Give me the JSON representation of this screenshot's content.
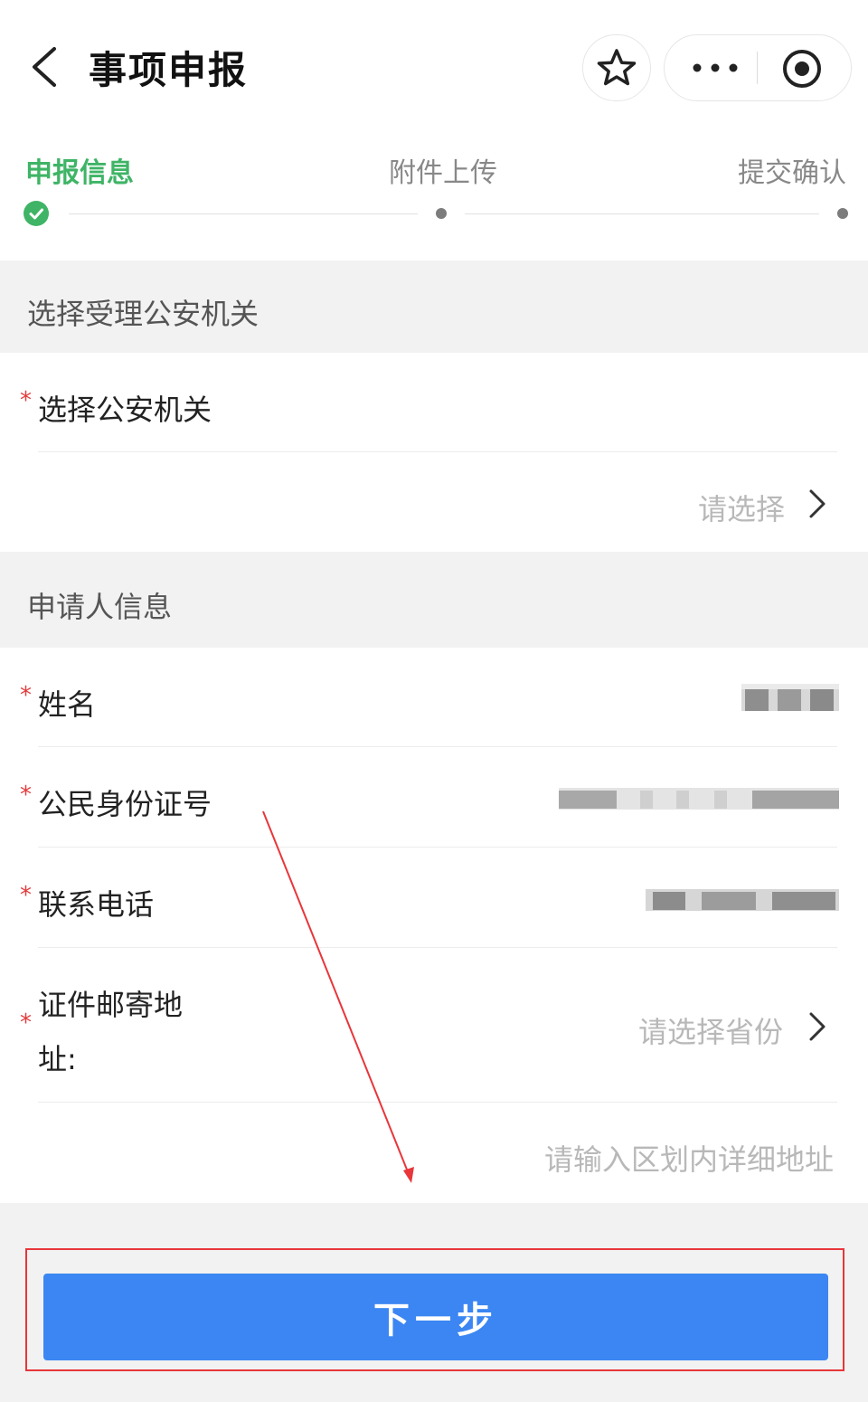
{
  "nav": {
    "title": "事项申报",
    "back_icon": "chevron-left-icon",
    "favorite_icon": "star-icon",
    "more_icon": "more-dots-icon",
    "close_icon": "target-circle-icon"
  },
  "steps": {
    "items": [
      {
        "label": "申报信息",
        "status": "done"
      },
      {
        "label": "附件上传",
        "status": "pending"
      },
      {
        "label": "提交确认",
        "status": "pending"
      }
    ],
    "active_color": "#3fb466"
  },
  "police_section": {
    "title": "选择受理公安机关",
    "field_label": "选择公安机关",
    "required_mark": "*",
    "placeholder": "请选择"
  },
  "applicant_section": {
    "title": "申请人信息",
    "required_mark": "*",
    "name_label": "姓名",
    "id_label": "公民身份证号",
    "phone_label": "联系电话",
    "address_label_line1": "证件邮寄地",
    "address_label_line2": "址:",
    "province_placeholder": "请选择省份",
    "detail_placeholder": "请输入区划内详细地址"
  },
  "footer": {
    "next_label": "下一步",
    "button_color": "#3b86f2",
    "highlight_color": "#e8363a"
  }
}
